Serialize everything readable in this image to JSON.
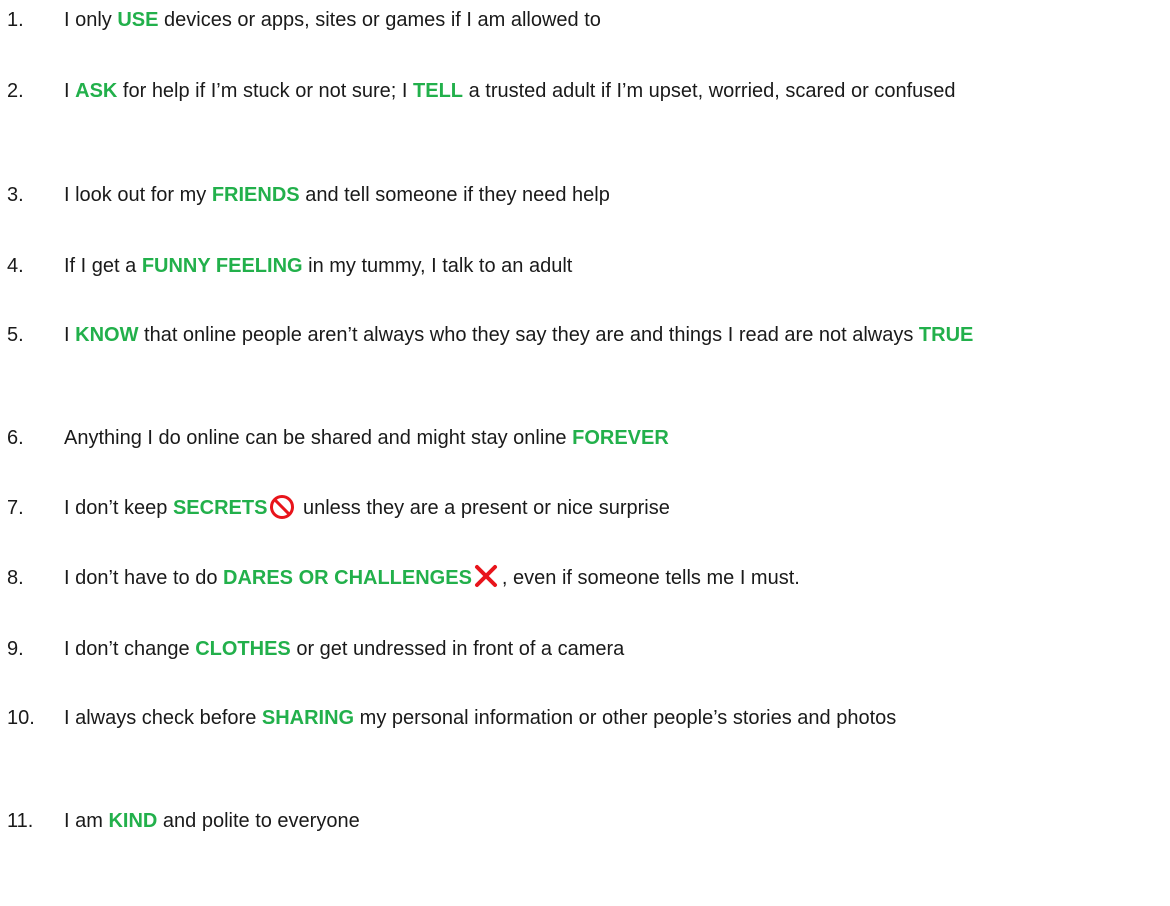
{
  "rules": [
    {
      "number": "1.",
      "segments": [
        {
          "t": "I only "
        },
        {
          "t": "USE",
          "k": true
        },
        {
          "t": " devices or apps, sites or games if I am allowed to"
        }
      ]
    },
    {
      "number": "2.",
      "segments": [
        {
          "t": "I "
        },
        {
          "t": "ASK",
          "k": true
        },
        {
          "t": " for help if I’m stuck or not sure; I "
        },
        {
          "t": "TELL",
          "k": true
        },
        {
          "t": " a trusted adult if I’m upset, worried, scared or confused"
        }
      ]
    },
    {
      "number": "3.",
      "segments": [
        {
          "t": "I look out for my "
        },
        {
          "t": "FRIENDS",
          "k": true
        },
        {
          "t": " and tell someone if they need help"
        }
      ]
    },
    {
      "number": "4.",
      "segments": [
        {
          "t": "If I get a "
        },
        {
          "t": "FUNNY FEELING",
          "k": true
        },
        {
          "t": " in my tummy, I talk to an adult"
        }
      ]
    },
    {
      "number": "5.",
      "justify": true,
      "segments": [
        {
          "t": "I "
        },
        {
          "t": "KNOW",
          "k": true
        },
        {
          "t": " that online people aren’t always who they say they are and things I read are not always "
        },
        {
          "t": "TRUE",
          "k": true
        }
      ]
    },
    {
      "number": "6.",
      "segments": [
        {
          "t": "Anything I do online can be shared and might stay online "
        },
        {
          "t": "FOREVER",
          "k": true
        }
      ]
    },
    {
      "number": "7.",
      "segments": [
        {
          "t": "I don’t keep "
        },
        {
          "t": "SECRETS",
          "k": true
        },
        {
          "icon": "no-entry-icon"
        },
        {
          "t": " unless they are a present or nice surprise"
        }
      ]
    },
    {
      "number": "8.",
      "segments": [
        {
          "t": "I don’t have to do "
        },
        {
          "t": "DARES OR CHALLENGES",
          "k": true
        },
        {
          "icon": "cross-icon"
        },
        {
          "t": ", even if someone tells me I must."
        }
      ]
    },
    {
      "number": "9.",
      "segments": [
        {
          "t": "I don’t change "
        },
        {
          "t": "CLOTHES",
          "k": true
        },
        {
          "t": " or get undressed in front of a camera"
        }
      ]
    },
    {
      "number": "10.",
      "segments": [
        {
          "t": "I always check before "
        },
        {
          "t": "SHARING",
          "k": true
        },
        {
          "t": " my personal information or other people’s stories and photos"
        }
      ]
    },
    {
      "number": "11.",
      "segments": [
        {
          "t": "I am "
        },
        {
          "t": "KIND",
          "k": true
        },
        {
          "t": " and polite to everyone"
        }
      ]
    }
  ],
  "colors": {
    "keyword": "#22b04b",
    "text": "#1a1a1a",
    "icon": "#e8141b"
  }
}
